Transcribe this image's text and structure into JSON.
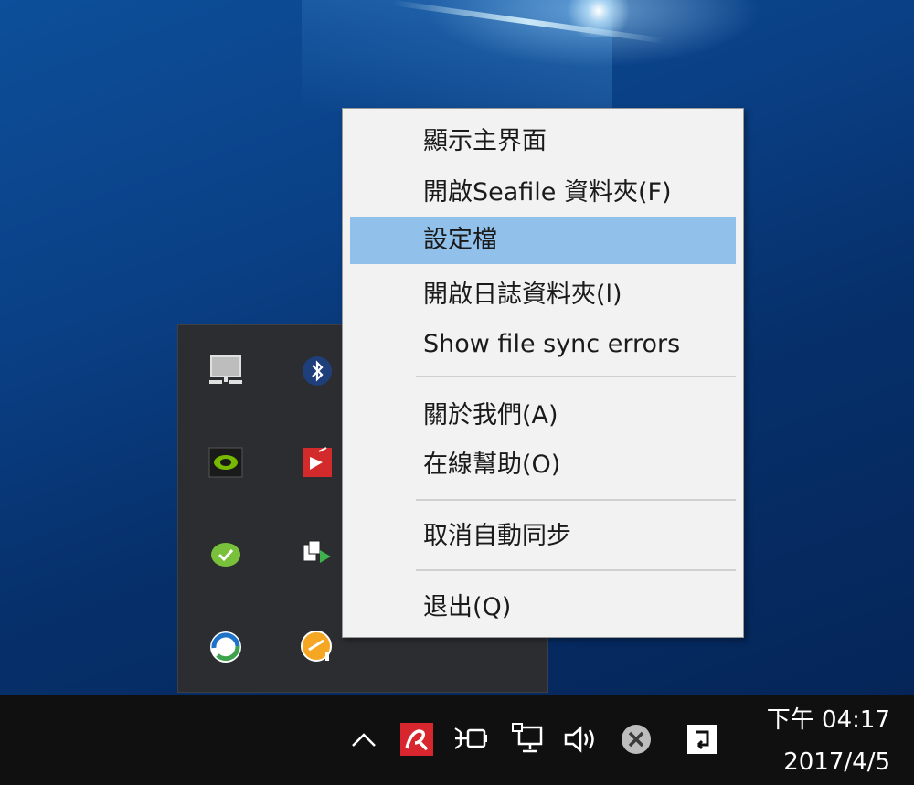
{
  "context_menu": {
    "items": [
      {
        "label": "顯示主界面"
      },
      {
        "label": "開啟Seafile 資料夾(F)"
      },
      {
        "label": "設定檔"
      },
      {
        "label": "開啟日誌資料夾(l)"
      },
      {
        "label": "Show file sync errors"
      },
      {
        "label": "關於我們(A)"
      },
      {
        "label": "在線幫助(O)"
      },
      {
        "label": "取消自動同步"
      },
      {
        "label": "退出(Q)"
      }
    ],
    "highlighted_index": 2,
    "highlight_color": "#91c1ea"
  },
  "tray_overflow": {
    "icons": [
      {
        "icon": "network-monitor-icon"
      },
      {
        "icon": "bluetooth-icon"
      },
      {
        "icon": "nvidia-icon"
      },
      {
        "icon": "red-app-icon"
      },
      {
        "icon": "green-check-cloud-icon"
      },
      {
        "icon": "media-play-icon"
      },
      {
        "icon": "blue-sync-icon"
      },
      {
        "icon": "orange-alert-icon"
      }
    ]
  },
  "taskbar": {
    "icons": [
      {
        "icon": "chevron-up-icon"
      },
      {
        "icon": "avira-icon"
      },
      {
        "icon": "power-plug-icon"
      },
      {
        "icon": "network-icon"
      },
      {
        "icon": "volume-icon"
      },
      {
        "icon": "close-circle-icon"
      },
      {
        "icon": "notification-icon"
      }
    ],
    "clock": {
      "time": "下午 04:17",
      "date": "2017/4/5"
    }
  }
}
